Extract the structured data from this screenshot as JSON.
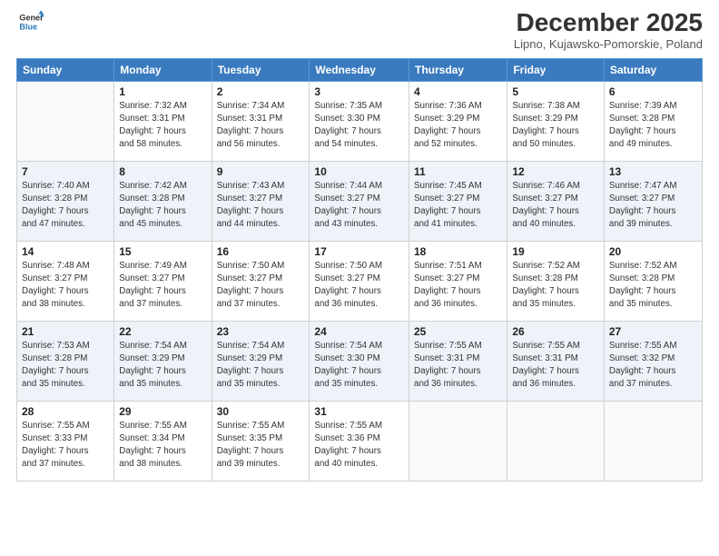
{
  "header": {
    "logo_line1": "General",
    "logo_line2": "Blue",
    "month": "December 2025",
    "location": "Lipno, Kujawsko-Pomorskie, Poland"
  },
  "weekdays": [
    "Sunday",
    "Monday",
    "Tuesday",
    "Wednesday",
    "Thursday",
    "Friday",
    "Saturday"
  ],
  "weeks": [
    [
      {
        "day": "",
        "info": ""
      },
      {
        "day": "1",
        "info": "Sunrise: 7:32 AM\nSunset: 3:31 PM\nDaylight: 7 hours\nand 58 minutes."
      },
      {
        "day": "2",
        "info": "Sunrise: 7:34 AM\nSunset: 3:31 PM\nDaylight: 7 hours\nand 56 minutes."
      },
      {
        "day": "3",
        "info": "Sunrise: 7:35 AM\nSunset: 3:30 PM\nDaylight: 7 hours\nand 54 minutes."
      },
      {
        "day": "4",
        "info": "Sunrise: 7:36 AM\nSunset: 3:29 PM\nDaylight: 7 hours\nand 52 minutes."
      },
      {
        "day": "5",
        "info": "Sunrise: 7:38 AM\nSunset: 3:29 PM\nDaylight: 7 hours\nand 50 minutes."
      },
      {
        "day": "6",
        "info": "Sunrise: 7:39 AM\nSunset: 3:28 PM\nDaylight: 7 hours\nand 49 minutes."
      }
    ],
    [
      {
        "day": "7",
        "info": "Sunrise: 7:40 AM\nSunset: 3:28 PM\nDaylight: 7 hours\nand 47 minutes."
      },
      {
        "day": "8",
        "info": "Sunrise: 7:42 AM\nSunset: 3:28 PM\nDaylight: 7 hours\nand 45 minutes."
      },
      {
        "day": "9",
        "info": "Sunrise: 7:43 AM\nSunset: 3:27 PM\nDaylight: 7 hours\nand 44 minutes."
      },
      {
        "day": "10",
        "info": "Sunrise: 7:44 AM\nSunset: 3:27 PM\nDaylight: 7 hours\nand 43 minutes."
      },
      {
        "day": "11",
        "info": "Sunrise: 7:45 AM\nSunset: 3:27 PM\nDaylight: 7 hours\nand 41 minutes."
      },
      {
        "day": "12",
        "info": "Sunrise: 7:46 AM\nSunset: 3:27 PM\nDaylight: 7 hours\nand 40 minutes."
      },
      {
        "day": "13",
        "info": "Sunrise: 7:47 AM\nSunset: 3:27 PM\nDaylight: 7 hours\nand 39 minutes."
      }
    ],
    [
      {
        "day": "14",
        "info": "Sunrise: 7:48 AM\nSunset: 3:27 PM\nDaylight: 7 hours\nand 38 minutes."
      },
      {
        "day": "15",
        "info": "Sunrise: 7:49 AM\nSunset: 3:27 PM\nDaylight: 7 hours\nand 37 minutes."
      },
      {
        "day": "16",
        "info": "Sunrise: 7:50 AM\nSunset: 3:27 PM\nDaylight: 7 hours\nand 37 minutes."
      },
      {
        "day": "17",
        "info": "Sunrise: 7:50 AM\nSunset: 3:27 PM\nDaylight: 7 hours\nand 36 minutes."
      },
      {
        "day": "18",
        "info": "Sunrise: 7:51 AM\nSunset: 3:27 PM\nDaylight: 7 hours\nand 36 minutes."
      },
      {
        "day": "19",
        "info": "Sunrise: 7:52 AM\nSunset: 3:28 PM\nDaylight: 7 hours\nand 35 minutes."
      },
      {
        "day": "20",
        "info": "Sunrise: 7:52 AM\nSunset: 3:28 PM\nDaylight: 7 hours\nand 35 minutes."
      }
    ],
    [
      {
        "day": "21",
        "info": "Sunrise: 7:53 AM\nSunset: 3:28 PM\nDaylight: 7 hours\nand 35 minutes."
      },
      {
        "day": "22",
        "info": "Sunrise: 7:54 AM\nSunset: 3:29 PM\nDaylight: 7 hours\nand 35 minutes."
      },
      {
        "day": "23",
        "info": "Sunrise: 7:54 AM\nSunset: 3:29 PM\nDaylight: 7 hours\nand 35 minutes."
      },
      {
        "day": "24",
        "info": "Sunrise: 7:54 AM\nSunset: 3:30 PM\nDaylight: 7 hours\nand 35 minutes."
      },
      {
        "day": "25",
        "info": "Sunrise: 7:55 AM\nSunset: 3:31 PM\nDaylight: 7 hours\nand 36 minutes."
      },
      {
        "day": "26",
        "info": "Sunrise: 7:55 AM\nSunset: 3:31 PM\nDaylight: 7 hours\nand 36 minutes."
      },
      {
        "day": "27",
        "info": "Sunrise: 7:55 AM\nSunset: 3:32 PM\nDaylight: 7 hours\nand 37 minutes."
      }
    ],
    [
      {
        "day": "28",
        "info": "Sunrise: 7:55 AM\nSunset: 3:33 PM\nDaylight: 7 hours\nand 37 minutes."
      },
      {
        "day": "29",
        "info": "Sunrise: 7:55 AM\nSunset: 3:34 PM\nDaylight: 7 hours\nand 38 minutes."
      },
      {
        "day": "30",
        "info": "Sunrise: 7:55 AM\nSunset: 3:35 PM\nDaylight: 7 hours\nand 39 minutes."
      },
      {
        "day": "31",
        "info": "Sunrise: 7:55 AM\nSunset: 3:36 PM\nDaylight: 7 hours\nand 40 minutes."
      },
      {
        "day": "",
        "info": ""
      },
      {
        "day": "",
        "info": ""
      },
      {
        "day": "",
        "info": ""
      }
    ]
  ]
}
